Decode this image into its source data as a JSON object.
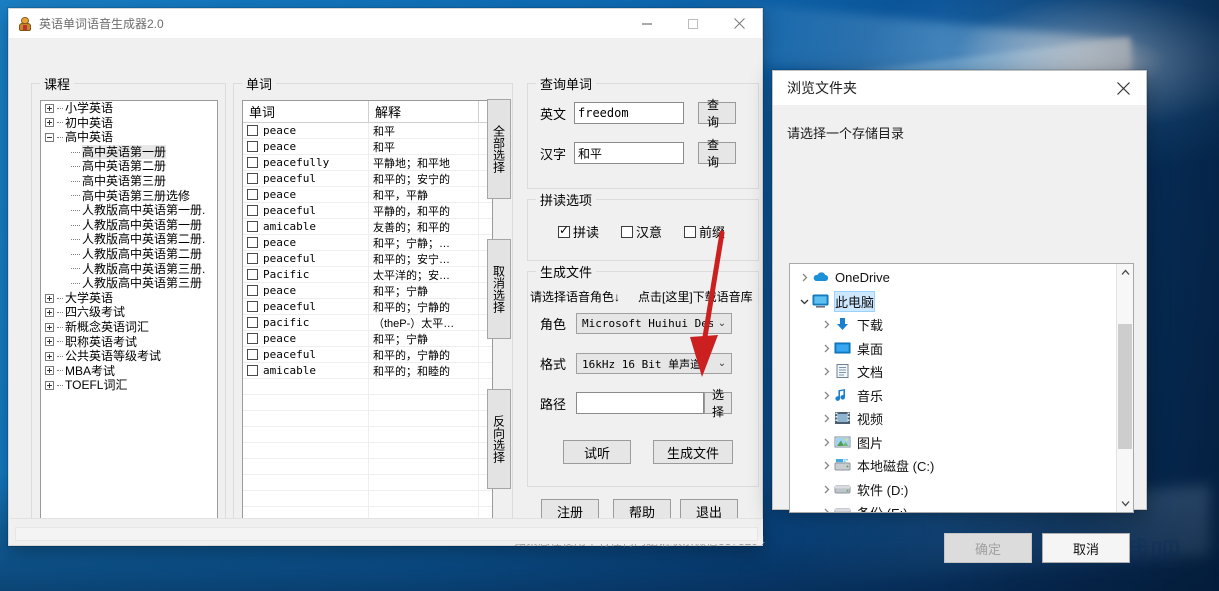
{
  "desktop": {
    "watermark_text": "下载吧",
    "watermark_url": "www.xiazaiba.com"
  },
  "main_window": {
    "title": "英语单词语音生成器2.0",
    "icon": "app-icon",
    "minimize": "—",
    "maximize": "□",
    "close": "✕",
    "status_text": "如果您在使用中有任何问题请联系微信3373294"
  },
  "course_panel": {
    "legend": "课程",
    "tree": [
      {
        "label": "小学英语",
        "level": 0,
        "state": "collapsed"
      },
      {
        "label": "初中英语",
        "level": 0,
        "state": "collapsed"
      },
      {
        "label": "高中英语",
        "level": 0,
        "state": "expanded"
      },
      {
        "label": "高中英语第一册",
        "level": 1,
        "state": "leaf",
        "selected": true
      },
      {
        "label": "高中英语第二册",
        "level": 1,
        "state": "leaf"
      },
      {
        "label": "高中英语第三册",
        "level": 1,
        "state": "leaf"
      },
      {
        "label": "高中英语第三册选修",
        "level": 1,
        "state": "leaf"
      },
      {
        "label": "人教版高中英语第一册.",
        "level": 1,
        "state": "leaf"
      },
      {
        "label": "人教版高中英语第一册",
        "level": 1,
        "state": "leaf"
      },
      {
        "label": "人教版高中英语第二册.",
        "level": 1,
        "state": "leaf"
      },
      {
        "label": "人教版高中英语第二册",
        "level": 1,
        "state": "leaf"
      },
      {
        "label": "人教版高中英语第三册.",
        "level": 1,
        "state": "leaf"
      },
      {
        "label": "人教版高中英语第三册",
        "level": 1,
        "state": "leaf"
      },
      {
        "label": "大学英语",
        "level": 0,
        "state": "collapsed"
      },
      {
        "label": "四六级考试",
        "level": 0,
        "state": "collapsed"
      },
      {
        "label": "新概念英语词汇",
        "level": 0,
        "state": "collapsed"
      },
      {
        "label": "职称英语考试",
        "level": 0,
        "state": "collapsed"
      },
      {
        "label": "公共英语等级考试",
        "level": 0,
        "state": "collapsed"
      },
      {
        "label": "MBA考试",
        "level": 0,
        "state": "collapsed"
      },
      {
        "label": "TOEFL词汇",
        "level": 0,
        "state": "collapsed"
      }
    ],
    "scroll_left_arrow": "‹",
    "scroll_right_arrow": "›"
  },
  "word_panel": {
    "legend": "单词",
    "columns": [
      "单词",
      "解释"
    ],
    "rows": [
      {
        "word": "peace",
        "meaning": "和平"
      },
      {
        "word": "peace",
        "meaning": "和平"
      },
      {
        "word": "peacefully",
        "meaning": "平静地；和平地"
      },
      {
        "word": "peaceful",
        "meaning": "和平的；安宁的"
      },
      {
        "word": "peace",
        "meaning": "和平，平静"
      },
      {
        "word": "peaceful",
        "meaning": "平静的，和平的"
      },
      {
        "word": "amicable",
        "meaning": "友善的；和平的"
      },
      {
        "word": "peace",
        "meaning": "和平；宁静；…"
      },
      {
        "word": "peaceful",
        "meaning": "和平的；安宁…"
      },
      {
        "word": "Pacific",
        "meaning": "太平洋的；安…"
      },
      {
        "word": "peace",
        "meaning": "和平；宁静"
      },
      {
        "word": "peaceful",
        "meaning": "和平的；宁静的"
      },
      {
        "word": "pacific",
        "meaning": "（theP-）太平…"
      },
      {
        "word": "peace",
        "meaning": "和平；宁静"
      },
      {
        "word": "peaceful",
        "meaning": "和平的，宁静的"
      },
      {
        "word": "amicable",
        "meaning": "和平的；和睦的"
      }
    ],
    "empty_row_count": 9
  },
  "side_buttons": {
    "select_all": "全部选择",
    "deselect": "取消选择",
    "invert": "反向选择"
  },
  "query_group": {
    "legend": "查询单词",
    "english_label": "英文",
    "english_value": "freedom",
    "english_button": "查询",
    "chinese_label": "汉字",
    "chinese_value": "和平",
    "chinese_button": "查询"
  },
  "pronounce_group": {
    "legend": "拼读选项",
    "options": [
      {
        "label": "拼读",
        "checked": true
      },
      {
        "label": "汉意",
        "checked": false
      },
      {
        "label": "前缀",
        "checked": false
      }
    ]
  },
  "generate_group": {
    "legend": "生成文件",
    "hint_left": "请选择语音角色↓",
    "hint_right": "点击[这里]下载语音库",
    "role_label": "角色",
    "role_value": "Microsoft Huihui Deskt·",
    "format_label": "格式",
    "format_value": "16kHz 16 Bit 单声道",
    "path_label": "路径",
    "path_value": "",
    "path_button": "选择",
    "preview_button": "试听",
    "generate_button": "生成文件",
    "dropdown_arrow": "⌄"
  },
  "bottom_buttons": {
    "register": "注册",
    "help": "帮助",
    "exit": "退出"
  },
  "folder_dialog": {
    "title": "浏览文件夹",
    "close": "✕",
    "prompt": "请选择一个存储目录",
    "tree": [
      {
        "label": "OneDrive",
        "level": 0,
        "icon": "cloud-icon",
        "chevron": "collapsed"
      },
      {
        "label": "此电脑",
        "level": 0,
        "icon": "computer-icon",
        "chevron": "expanded",
        "selected": true
      },
      {
        "label": "下载",
        "level": 1,
        "icon": "download-icon",
        "chevron": "collapsed"
      },
      {
        "label": "桌面",
        "level": 1,
        "icon": "desktop-icon",
        "chevron": "collapsed"
      },
      {
        "label": "文档",
        "level": 1,
        "icon": "document-icon",
        "chevron": "collapsed"
      },
      {
        "label": "音乐",
        "level": 1,
        "icon": "music-icon",
        "chevron": "collapsed"
      },
      {
        "label": "视频",
        "level": 1,
        "icon": "video-icon",
        "chevron": "collapsed"
      },
      {
        "label": "图片",
        "level": 1,
        "icon": "picture-icon",
        "chevron": "collapsed"
      },
      {
        "label": "本地磁盘 (C:)",
        "level": 1,
        "icon": "sysdrive-icon",
        "chevron": "collapsed"
      },
      {
        "label": "软件 (D:)",
        "level": 1,
        "icon": "drive-icon",
        "chevron": "collapsed"
      },
      {
        "label": "备份 (E:)",
        "level": 1,
        "icon": "drive-icon",
        "chevron": "collapsed"
      }
    ],
    "scroll_up": "⌃",
    "scroll_down": "⌄",
    "ok_button": "确定",
    "ok_disabled": true,
    "cancel_button": "取消"
  },
  "colors": {
    "desktop_blue": "#0e6ab3",
    "window_chrome": "#f0f0f0",
    "accent_selection": "#cde8ff",
    "arrow_red": "#cc2020"
  }
}
